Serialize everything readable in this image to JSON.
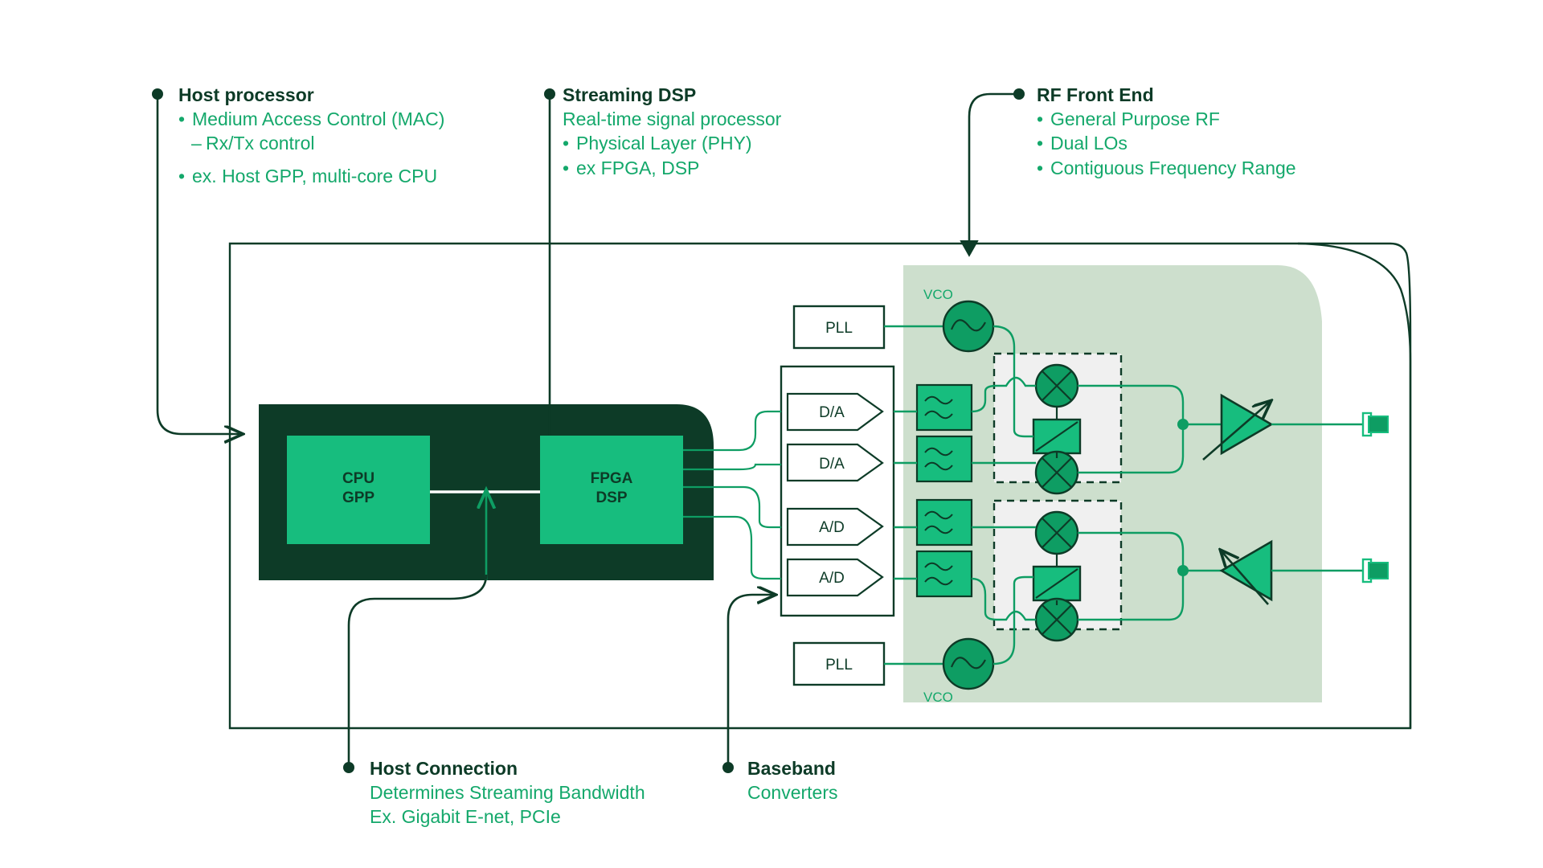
{
  "colors": {
    "dark_green": "#0d3b27",
    "mid_green": "#0e9d63",
    "bright_green": "#17bd7e",
    "accent_green": "#14a86b",
    "rf_region_fill": "#cddfcd",
    "mixer_region_fill": "#f0f0f0",
    "white": "#ffffff",
    "background": "#ffffff"
  },
  "callouts": [
    {
      "id": "host-processor",
      "title": "Host processor",
      "lines": [
        {
          "style": "bullet",
          "text": "Medium Access Control (MAC)"
        },
        {
          "style": "dash",
          "text": "Rx/Tx control"
        },
        {
          "style": "gap",
          "text": ""
        },
        {
          "style": "bullet",
          "text": "ex. Host GPP, multi-core CPU"
        }
      ]
    },
    {
      "id": "streaming-dsp",
      "title": "Streaming DSP",
      "lines": [
        {
          "style": "plain",
          "text": "Real-time signal processor"
        },
        {
          "style": "bullet",
          "text": "Physical Layer (PHY)"
        },
        {
          "style": "bullet",
          "text": "ex FPGA, DSP"
        }
      ]
    },
    {
      "id": "rf-front-end",
      "title": "RF Front End",
      "lines": [
        {
          "style": "bullet",
          "text": "General Purpose RF"
        },
        {
          "style": "bullet",
          "text": "Dual LOs"
        },
        {
          "style": "bullet",
          "text": "Contiguous Frequency Range"
        }
      ]
    },
    {
      "id": "host-connection",
      "title": "Host Connection",
      "lines": [
        {
          "style": "plain",
          "text": "Determines Streaming Bandwidth"
        },
        {
          "style": "plain",
          "text": "Ex. Gigabit E-net, PCIe"
        }
      ]
    },
    {
      "id": "baseband",
      "title": "Baseband",
      "lines": [
        {
          "style": "plain",
          "text": "Converters"
        }
      ]
    }
  ],
  "blocks": {
    "cpu": {
      "line1": "CPU",
      "line2": "GPP"
    },
    "fpga": {
      "line1": "FPGA",
      "line2": "DSP"
    },
    "pll_top": "PLL",
    "pll_bottom": "PLL",
    "vco_top": "VCO",
    "vco_bottom": "VCO",
    "converters": [
      {
        "name": "dac-1",
        "label": "D/A"
      },
      {
        "name": "dac-2",
        "label": "D/A"
      },
      {
        "name": "adc-1",
        "label": "A/D"
      },
      {
        "name": "adc-2",
        "label": "A/D"
      }
    ]
  },
  "icons": {
    "vco": "sine-wave-icon",
    "filter": "filter-icon",
    "mixer": "mixer-x-icon",
    "phase_shifter": "phase-shifter-icon",
    "amplifier_tx": "variable-amplifier-tx-icon",
    "amplifier_rx": "variable-amplifier-rx-icon",
    "antenna_port": "antenna-connector-icon"
  }
}
